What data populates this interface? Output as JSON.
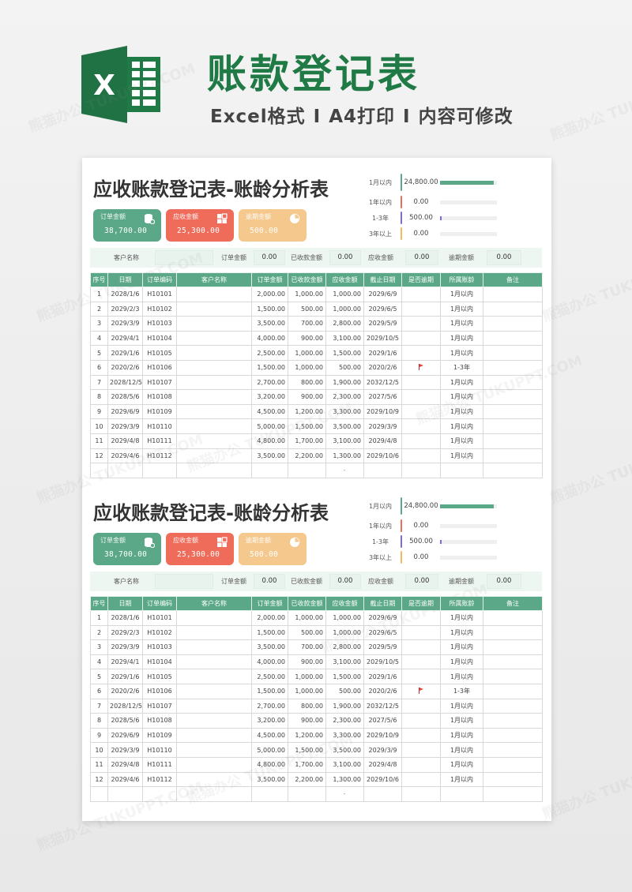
{
  "banner": {
    "title": "账款登记表",
    "subtitle_parts": [
      "Excel格式",
      "I",
      "A4打印",
      "I",
      "内容可修改"
    ],
    "logo_letter": "X"
  },
  "colors": {
    "brand_green": "#1f7a45",
    "header_green": "#5aa887",
    "order_card": "#5aa887",
    "receivable_card": "#ef6b5a",
    "overdue_card": "#f5c88d",
    "aging_1m": "#5aa887",
    "aging_1y": "#ef6b5a",
    "aging_1_3y": "#7b6be0",
    "aging_3y_plus": "#f5b860"
  },
  "watermark_text": "熊猫办公 TUKUPPT.COM",
  "sheets": [
    {
      "title": "应收账款登记表-账龄分析表",
      "cards": [
        {
          "label": "订单金额",
          "value": "38,700.00",
          "icon": "database-icon"
        },
        {
          "label": "应收金额",
          "value": "25,300.00",
          "icon": "grid-icon"
        },
        {
          "label": "逾期金额",
          "value": "500.00",
          "icon": "pie-chart-icon"
        }
      ],
      "aging": [
        {
          "label": "1月以内",
          "value": "24,800.00",
          "share": 1.0
        },
        {
          "label": "1年以内",
          "value": "0.00",
          "share": 0.0
        },
        {
          "label": "1-3年",
          "value": "500.00",
          "share": 0.02
        },
        {
          "label": "3年以上",
          "value": "0.00",
          "share": 0.0
        }
      ],
      "summary": {
        "customer_label": "客户名称",
        "customer_value": "",
        "order_label": "订单金额",
        "order_value": "0.00",
        "received_label": "已收款金额",
        "received_value": "0.00",
        "receivable_label": "应收金额",
        "receivable_value": "0.00",
        "overdue_label": "逾期金额",
        "overdue_value": "0.00"
      },
      "columns": [
        "序号",
        "日期",
        "订单编码",
        "客户名称",
        "订单金额",
        "已收款金额",
        "应收金额",
        "截止日期",
        "是否逾期",
        "所属账龄",
        "备注"
      ],
      "rows": [
        [
          "1",
          "2028/1/6",
          "H10101",
          "",
          "2,000.00",
          "1,000.00",
          "1,000.00",
          "2029/6/9",
          "",
          "1月以内",
          ""
        ],
        [
          "2",
          "2029/2/3",
          "H10102",
          "",
          "1,500.00",
          "500.00",
          "1,000.00",
          "2029/6/5",
          "",
          "1月以内",
          ""
        ],
        [
          "3",
          "2029/3/9",
          "H10103",
          "",
          "3,500.00",
          "700.00",
          "2,800.00",
          "2029/5/9",
          "",
          "1月以内",
          ""
        ],
        [
          "4",
          "2029/4/1",
          "H10104",
          "",
          "4,000.00",
          "900.00",
          "3,100.00",
          "2029/10/5",
          "",
          "1月以内",
          ""
        ],
        [
          "5",
          "2029/1/6",
          "H10105",
          "",
          "2,500.00",
          "1,000.00",
          "1,500.00",
          "2029/1/6",
          "",
          "1月以内",
          ""
        ],
        [
          "6",
          "2020/2/6",
          "H10106",
          "",
          "1,500.00",
          "1,000.00",
          "500.00",
          "2020/2/6",
          "flag",
          "1-3年",
          ""
        ],
        [
          "7",
          "2028/12/5",
          "H10107",
          "",
          "2,700.00",
          "800.00",
          "1,900.00",
          "2032/12/5",
          "",
          "1月以内",
          ""
        ],
        [
          "8",
          "2028/5/6",
          "H10108",
          "",
          "3,200.00",
          "900.00",
          "2,300.00",
          "2027/5/6",
          "",
          "1月以内",
          ""
        ],
        [
          "9",
          "2029/6/9",
          "H10109",
          "",
          "4,500.00",
          "1,200.00",
          "3,300.00",
          "2029/10/9",
          "",
          "1月以内",
          ""
        ],
        [
          "10",
          "2029/3/9",
          "H10110",
          "",
          "5,000.00",
          "1,500.00",
          "3,500.00",
          "2029/3/9",
          "",
          "1月以内",
          ""
        ],
        [
          "11",
          "2029/4/8",
          "H10111",
          "",
          "4,800.00",
          "1,700.00",
          "3,100.00",
          "2029/4/8",
          "",
          "1月以内",
          ""
        ],
        [
          "12",
          "2029/4/6",
          "H10112",
          "",
          "3,500.00",
          "2,200.00",
          "1,300.00",
          "2029/10/6",
          "",
          "1月以内",
          ""
        ],
        [
          "",
          "",
          "",
          "",
          "",
          "",
          "-",
          "",
          "",
          "",
          ""
        ]
      ]
    },
    {
      "title": "应收账款登记表-账龄分析表",
      "cards": [
        {
          "label": "订单金额",
          "value": "38,700.00",
          "icon": "database-icon"
        },
        {
          "label": "应收金额",
          "value": "25,300.00",
          "icon": "grid-icon"
        },
        {
          "label": "逾期金额",
          "value": "500.00",
          "icon": "pie-chart-icon"
        }
      ],
      "aging": [
        {
          "label": "1月以内",
          "value": "24,800.00",
          "share": 1.0
        },
        {
          "label": "1年以内",
          "value": "0.00",
          "share": 0.0
        },
        {
          "label": "1-3年",
          "value": "500.00",
          "share": 0.02
        },
        {
          "label": "3年以上",
          "value": "0.00",
          "share": 0.0
        }
      ],
      "summary": {
        "customer_label": "客户名称",
        "customer_value": "",
        "order_label": "订单金额",
        "order_value": "0.00",
        "received_label": "已收款金额",
        "received_value": "0.00",
        "receivable_label": "应收金额",
        "receivable_value": "0.00",
        "overdue_label": "逾期金额",
        "overdue_value": "0.00"
      },
      "columns": [
        "序号",
        "日期",
        "订单编码",
        "客户名称",
        "订单金额",
        "已收款金额",
        "应收金额",
        "截止日期",
        "是否逾期",
        "所属账龄",
        "备注"
      ],
      "rows": [
        [
          "1",
          "2028/1/6",
          "H10101",
          "",
          "2,000.00",
          "1,000.00",
          "1,000.00",
          "2029/6/9",
          "",
          "1月以内",
          ""
        ],
        [
          "2",
          "2029/2/3",
          "H10102",
          "",
          "1,500.00",
          "500.00",
          "1,000.00",
          "2029/6/5",
          "",
          "1月以内",
          ""
        ],
        [
          "3",
          "2029/3/9",
          "H10103",
          "",
          "3,500.00",
          "700.00",
          "2,800.00",
          "2029/5/9",
          "",
          "1月以内",
          ""
        ],
        [
          "4",
          "2029/4/1",
          "H10104",
          "",
          "4,000.00",
          "900.00",
          "3,100.00",
          "2029/10/5",
          "",
          "1月以内",
          ""
        ],
        [
          "5",
          "2029/1/6",
          "H10105",
          "",
          "2,500.00",
          "1,000.00",
          "1,500.00",
          "2029/1/6",
          "",
          "1月以内",
          ""
        ],
        [
          "6",
          "2020/2/6",
          "H10106",
          "",
          "1,500.00",
          "1,000.00",
          "500.00",
          "2020/2/6",
          "flag",
          "1-3年",
          ""
        ],
        [
          "7",
          "2028/12/5",
          "H10107",
          "",
          "2,700.00",
          "800.00",
          "1,900.00",
          "2032/12/5",
          "",
          "1月以内",
          ""
        ],
        [
          "8",
          "2028/5/6",
          "H10108",
          "",
          "3,200.00",
          "900.00",
          "2,300.00",
          "2027/5/6",
          "",
          "1月以内",
          ""
        ],
        [
          "9",
          "2029/6/9",
          "H10109",
          "",
          "4,500.00",
          "1,200.00",
          "3,300.00",
          "2029/10/9",
          "",
          "1月以内",
          ""
        ],
        [
          "10",
          "2029/3/9",
          "H10110",
          "",
          "5,000.00",
          "1,500.00",
          "3,500.00",
          "2029/3/9",
          "",
          "1月以内",
          ""
        ],
        [
          "11",
          "2029/4/8",
          "H10111",
          "",
          "4,800.00",
          "1,700.00",
          "3,100.00",
          "2029/4/8",
          "",
          "1月以内",
          ""
        ],
        [
          "12",
          "2029/4/6",
          "H10112",
          "",
          "3,500.00",
          "2,200.00",
          "1,300.00",
          "2029/10/6",
          "",
          "1月以内",
          ""
        ],
        [
          "",
          "",
          "",
          "",
          "",
          "",
          "-",
          "",
          "",
          "",
          ""
        ]
      ]
    }
  ]
}
